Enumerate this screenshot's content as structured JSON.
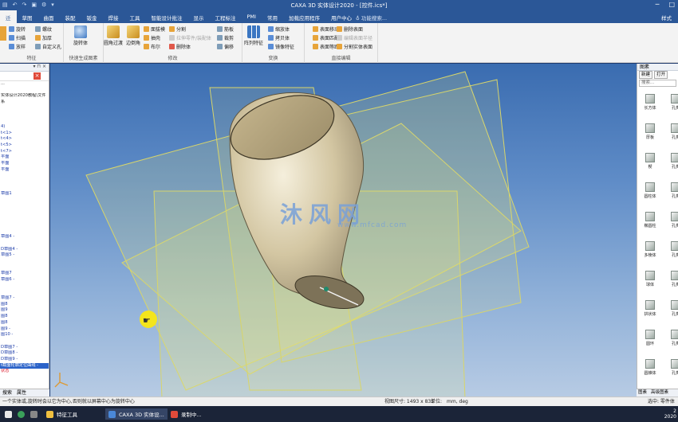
{
  "window": {
    "title": "CAXA 3D 实体设计2020 - [控件.ics*]"
  },
  "menu": {
    "tabs": [
      "迁",
      "草图",
      "曲面",
      "装配",
      "钣金",
      "焊接",
      "工具",
      "智能设计批注",
      "显示",
      "工程标注",
      "PMI",
      "常用",
      "加载应用程序",
      "用户中心"
    ],
    "search_placeholder": "功能搜索...",
    "style_label": "样式"
  },
  "ribbon": {
    "feature": {
      "label": "特征",
      "items": [
        "旋转",
        "扫描",
        "放样",
        "螺纹",
        "加厚",
        "自定义孔"
      ]
    },
    "quick": {
      "label": "快速生成图素",
      "big": "旋转体"
    },
    "modify": {
      "label": "修改",
      "big1": "圆角过渡",
      "big2": "边倒角",
      "items": [
        "面拔模",
        "抽壳",
        "布尔",
        "分割",
        "拉伸零件/装配体",
        "删除体",
        "筋板",
        "裁剪",
        "偏移"
      ]
    },
    "transform": {
      "label": "变换",
      "big": "阵列特征",
      "items": [
        "缩放体",
        "拷贝体",
        "镜像特征"
      ]
    },
    "direct": {
      "label": "直接编辑",
      "items": [
        "表面移动",
        "表面匹配",
        "表面等距",
        "删除表面",
        "编辑表面半径",
        "分割实体表面"
      ]
    }
  },
  "left_panel": {
    "close_icon": "close-icon",
    "tree": [
      "...",
      "",
      "实体设计2020教程\\文件",
      "系",
      "",
      "",
      "",
      "4)",
      "t<1>",
      "t<4>",
      "t<5>",
      "t<7>",
      "平面",
      "平面",
      "平面",
      "",
      "",
      "",
      "草图1",
      "",
      "",
      "",
      "",
      "",
      "",
      "草图4 -",
      "",
      "D草图4 -",
      "草图5 -",
      "",
      "",
      "草图7",
      "草图6 -",
      "",
      "",
      "草图7 -",
      "图8",
      "图9",
      "图8",
      "图8",
      "图9 -",
      "图10 -",
      "",
      "D草图7 -",
      "D草图8 -",
      "D草图9 -",
      "t截面轮廓定位曲线 -",
      "状态"
    ],
    "tabs": [
      "搜索",
      "属性"
    ]
  },
  "viewport": {
    "watermark": "沐风网",
    "watermark_url": "www.mfcad.com"
  },
  "right_panel": {
    "title": "图素",
    "buttons": [
      "新建",
      "打开"
    ],
    "search_placeholder": "搜索...",
    "items": [
      "长方体",
      "孔类",
      "厚板",
      "孔类",
      "楔",
      "孔类",
      "圆柱体",
      "孔类",
      "椭圆柱",
      "孔类",
      "多棱体",
      "孔类",
      "球体",
      "孔类",
      "拱状体",
      "孔类",
      "圆环",
      "孔类",
      "圆锥体",
      "孔类"
    ],
    "tabs": [
      "图素",
      "高级图素"
    ]
  },
  "status": {
    "message": "一个实体或,旋转时会以它为中心,否则就以屏幕中心为旋转中心",
    "view_size": "视图尺寸: 1493 x 835",
    "units_label": "单位:",
    "units": "mm, deg",
    "selector": "选中: 零件体"
  },
  "taskbar": {
    "items": [
      "特征工具",
      "CAXA 3D 实体设...",
      "录制中..."
    ],
    "time": "2",
    "date": "2020"
  }
}
